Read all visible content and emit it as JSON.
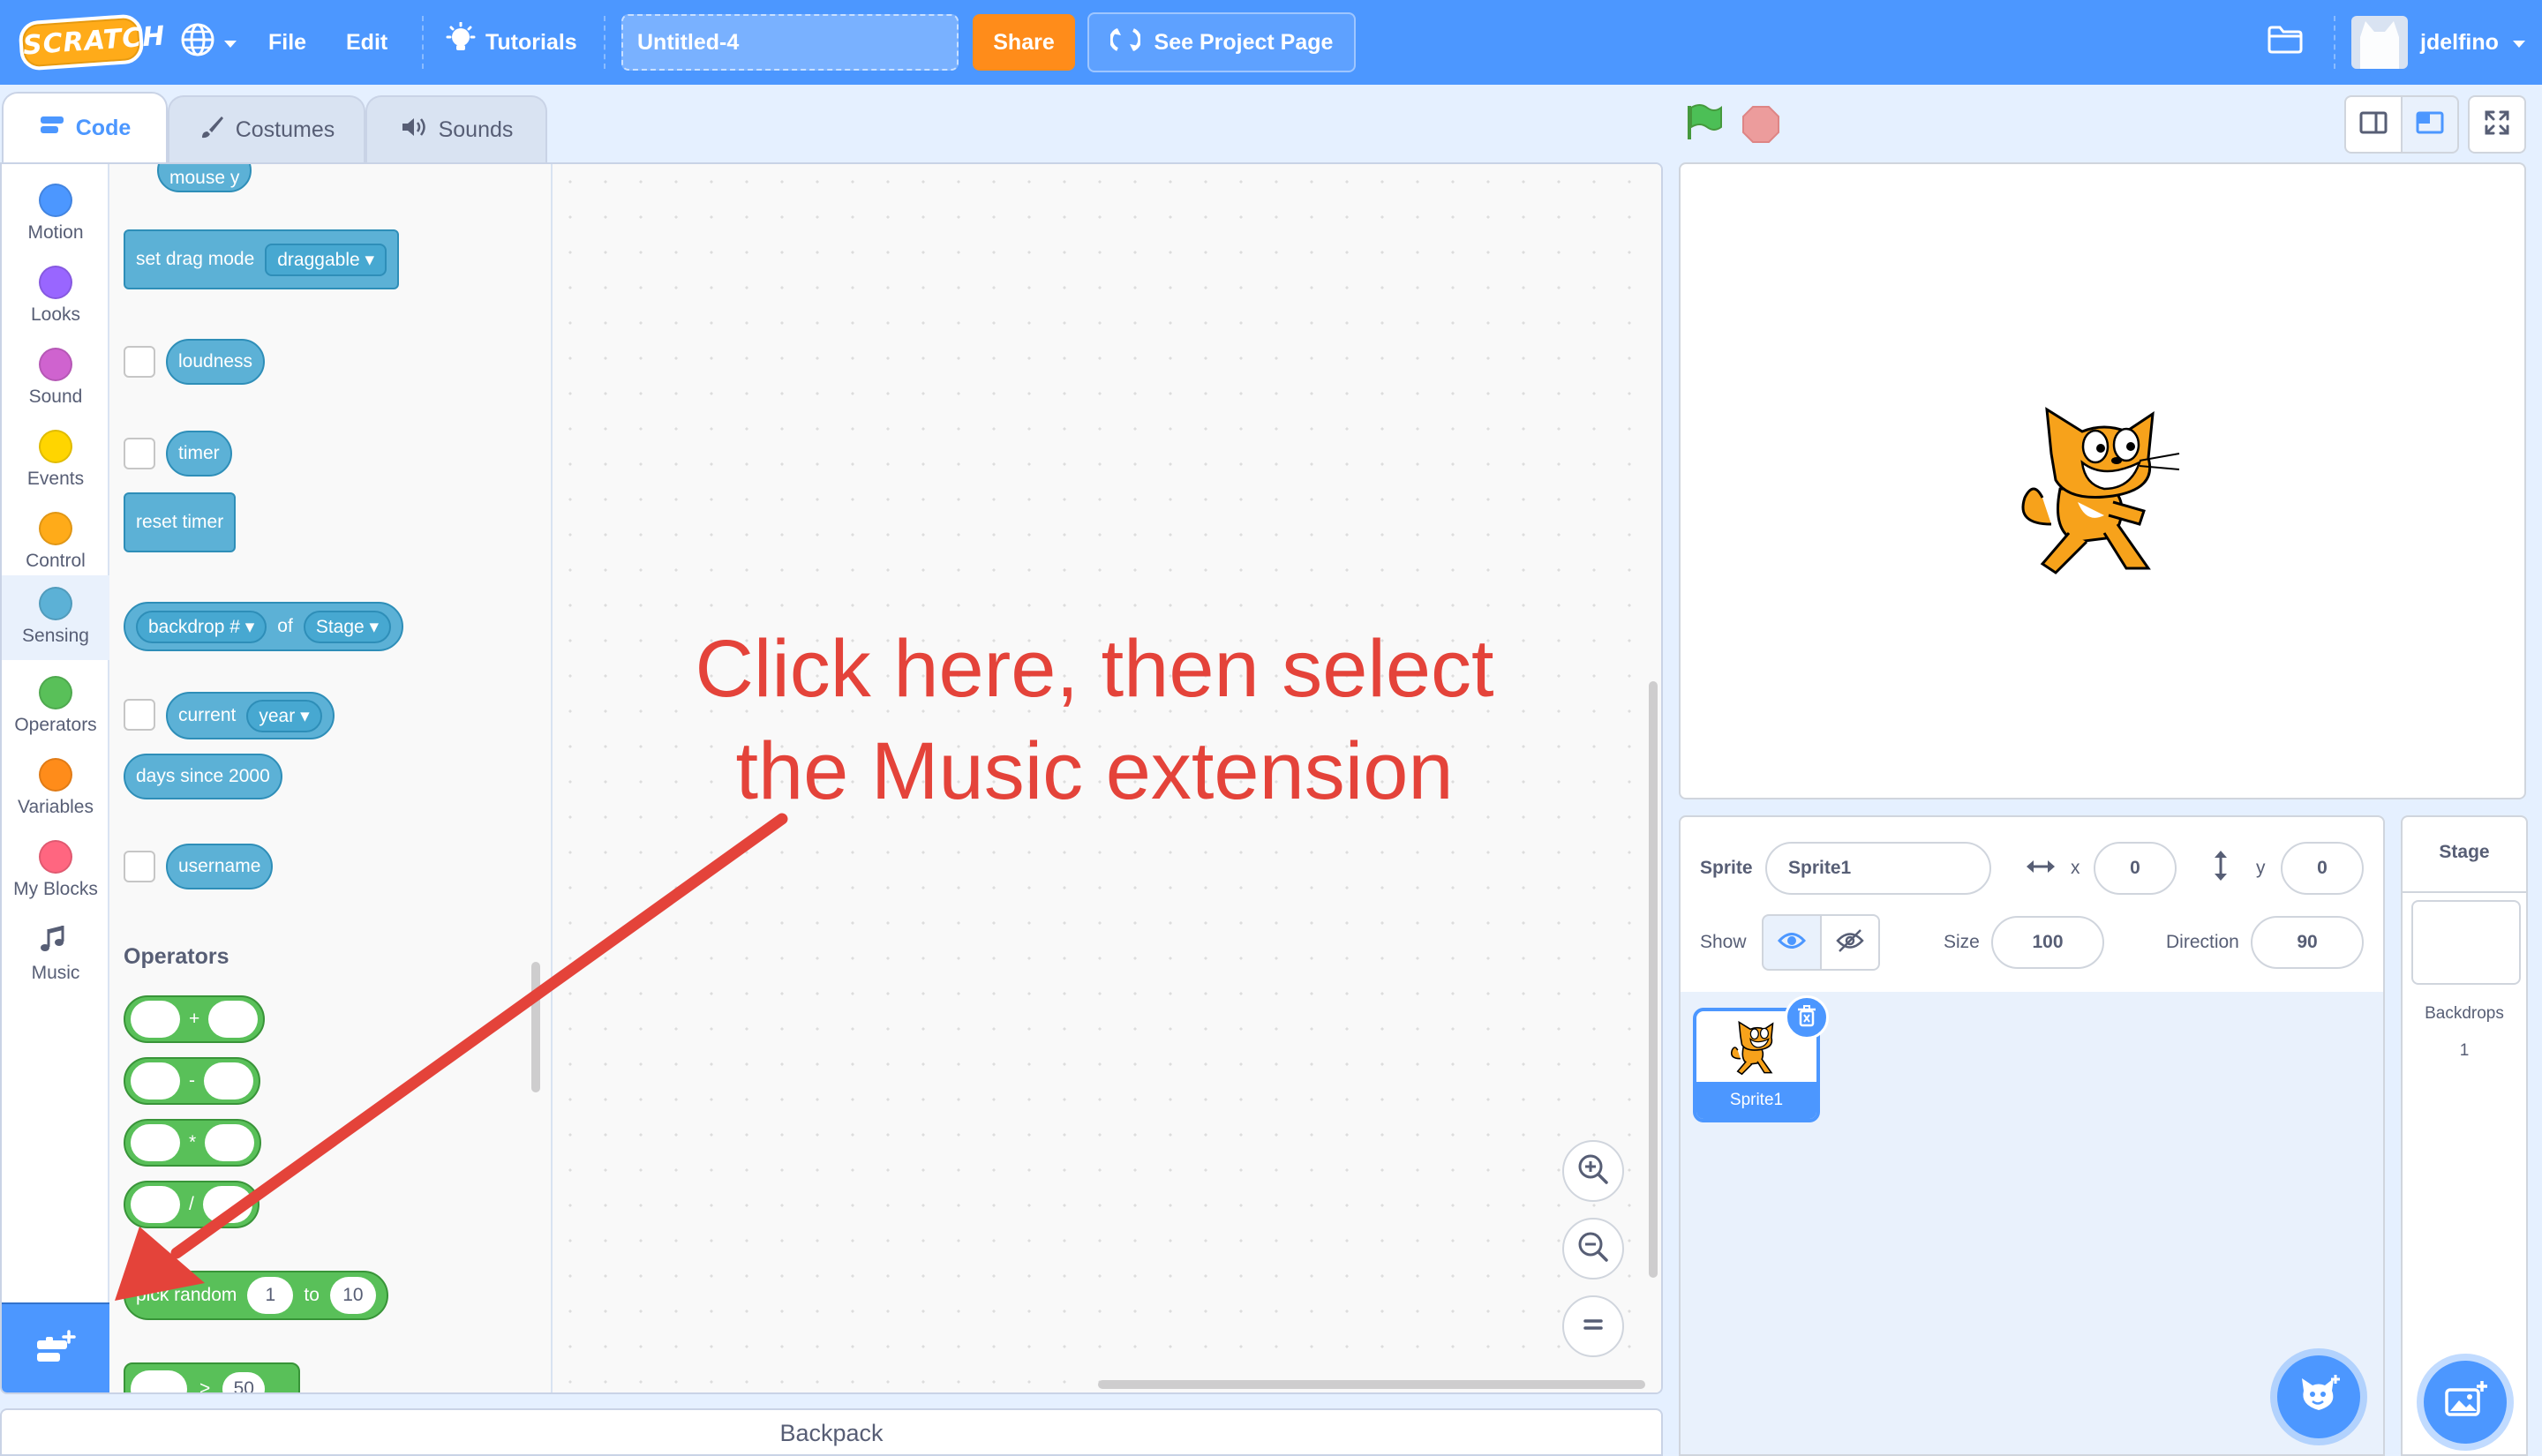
{
  "menubar": {
    "logo": "SCRATCH",
    "file": "File",
    "edit": "Edit",
    "tutorials": "Tutorials",
    "project_title": "Untitled-4",
    "share": "Share",
    "see_project_page": "See Project Page",
    "username": "jdelfino"
  },
  "tabs": {
    "code": "Code",
    "costumes": "Costumes",
    "sounds": "Sounds"
  },
  "categories": [
    {
      "label": "Motion",
      "color": "#4c97ff"
    },
    {
      "label": "Looks",
      "color": "#9966ff"
    },
    {
      "label": "Sound",
      "color": "#cf63cf"
    },
    {
      "label": "Events",
      "color": "#ffd500"
    },
    {
      "label": "Control",
      "color": "#ffab19"
    },
    {
      "label": "Sensing",
      "color": "#5cb1d6"
    },
    {
      "label": "Operators",
      "color": "#59c059"
    },
    {
      "label": "Variables",
      "color": "#ff8c1a"
    },
    {
      "label": "My Blocks",
      "color": "#ff6680"
    },
    {
      "label": "Music",
      "color": "#0fbd8c"
    }
  ],
  "blocks": {
    "mouse_y": "mouse y",
    "set_drag_mode": "set drag mode",
    "drag_option": "draggable",
    "loudness": "loudness",
    "timer": "timer",
    "reset_timer": "reset timer",
    "backdrop_num": "backdrop #",
    "of": "of",
    "stage": "Stage",
    "current": "current",
    "year": "year",
    "days_since": "days since 2000",
    "username": "username",
    "operators_heading": "Operators",
    "plus": "+",
    "minus": "-",
    "times": "*",
    "divide": "/",
    "pick_random": "pick random",
    "rand_from": "1",
    "to": "to",
    "rand_to": "10",
    "gt": ">",
    "gt_value": "50"
  },
  "annotation": {
    "line1": "Click here, then select",
    "line2": "the Music extension",
    "color": "#e4433a"
  },
  "backpack": "Backpack",
  "sprite_info": {
    "sprite_label": "Sprite",
    "sprite_name": "Sprite1",
    "x_label": "x",
    "x_value": "0",
    "y_label": "y",
    "y_value": "0",
    "show_label": "Show",
    "size_label": "Size",
    "size_value": "100",
    "direction_label": "Direction",
    "direction_value": "90"
  },
  "sprites": [
    {
      "name": "Sprite1"
    }
  ],
  "stage_panel": {
    "title": "Stage",
    "backdrops_label": "Backdrops",
    "backdrops_count": "1"
  }
}
